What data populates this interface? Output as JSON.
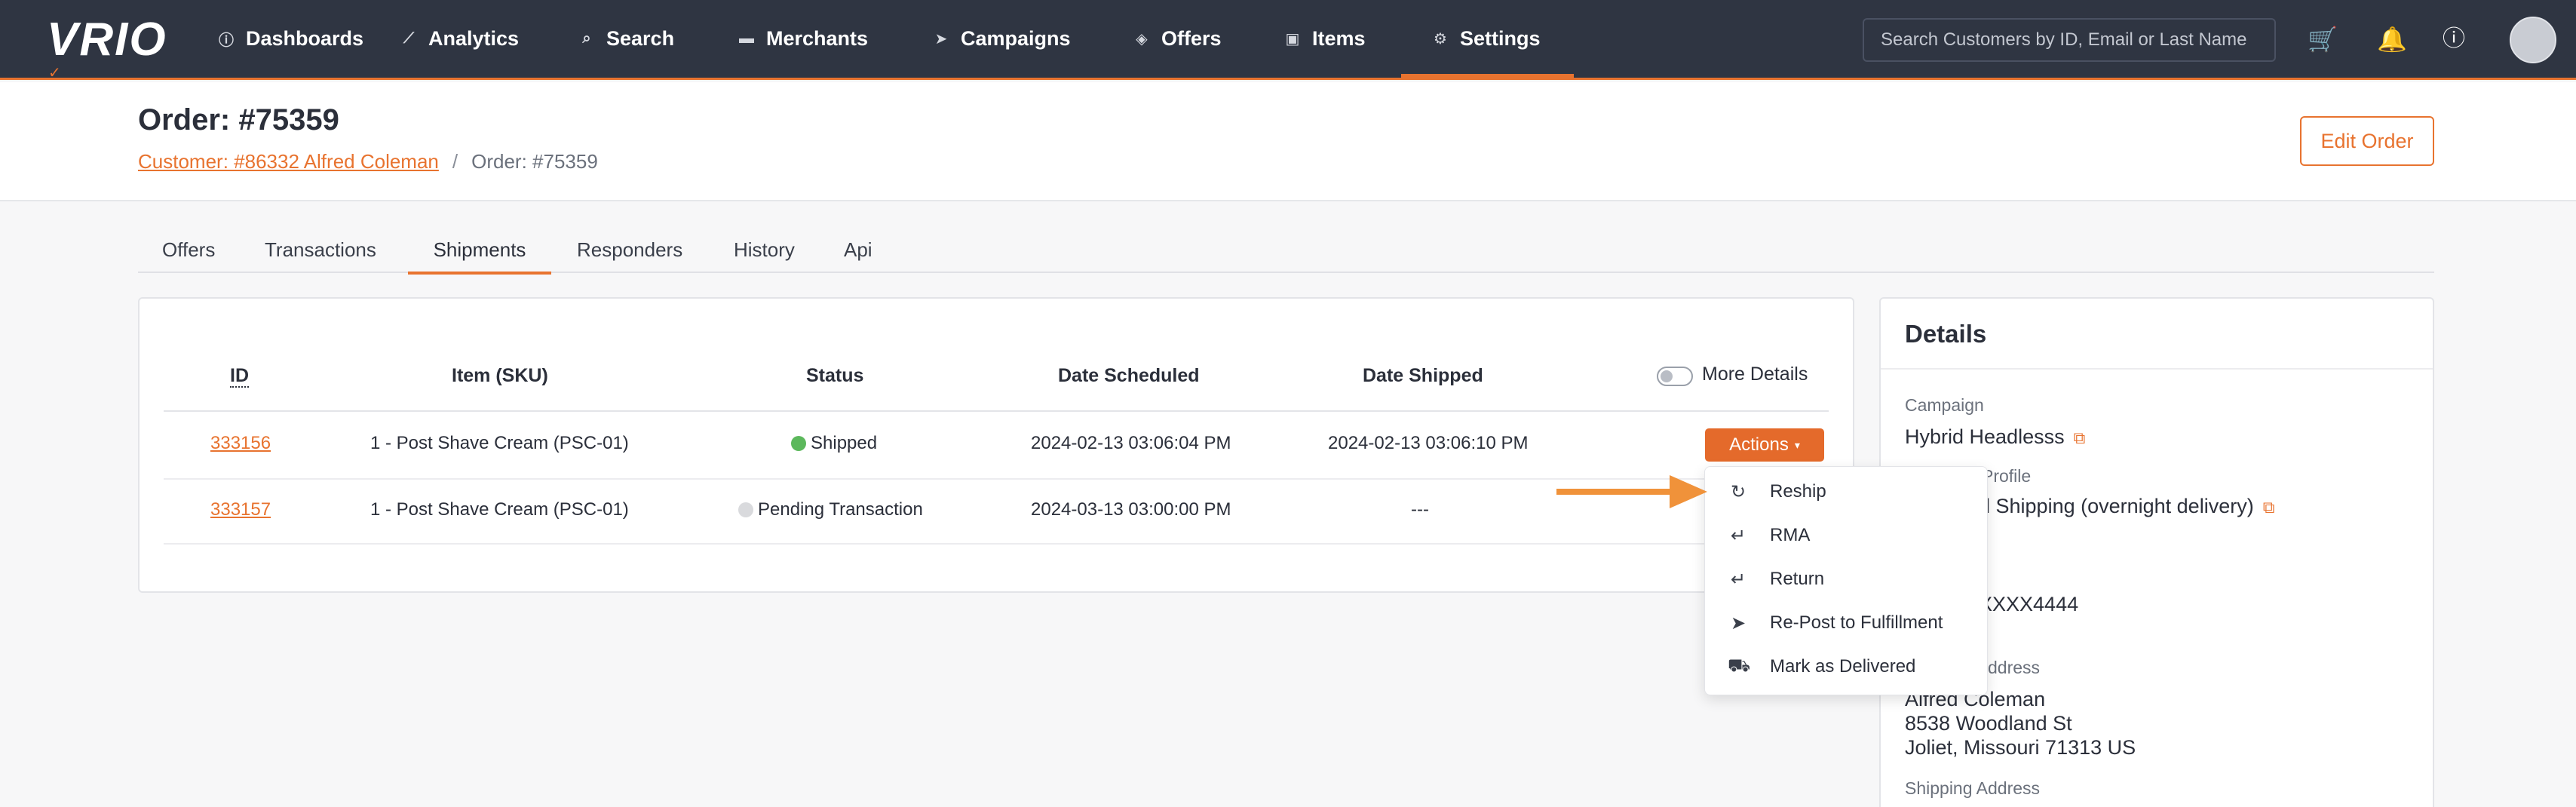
{
  "brand": {
    "logo": "VRIO"
  },
  "nav": {
    "items": [
      {
        "label": "Dashboards",
        "icon": "info-circle-icon"
      },
      {
        "label": "Analytics",
        "icon": "line-chart-icon"
      },
      {
        "label": "Search",
        "icon": "search-icon"
      },
      {
        "label": "Merchants",
        "icon": "card-icon"
      },
      {
        "label": "Campaigns",
        "icon": "paper-plane-icon"
      },
      {
        "label": "Offers",
        "icon": "layers-icon"
      },
      {
        "label": "Items",
        "icon": "box-icon"
      },
      {
        "label": "Settings",
        "icon": "gears-icon"
      }
    ],
    "active": "Settings",
    "search_placeholder": "Search Customers by ID, Email or Last Name"
  },
  "header": {
    "title": "Order: #75359",
    "breadcrumb": {
      "customer_link": "Customer: #86332 Alfred Coleman",
      "separator": "/",
      "current": "Order: #75359"
    },
    "edit_button": "Edit Order"
  },
  "tabs": [
    "Offers",
    "Transactions",
    "Shipments",
    "Responders",
    "History",
    "Api"
  ],
  "active_tab": "Shipments",
  "shipments": {
    "columns": [
      "ID",
      "Item (SKU)",
      "Status",
      "Date Scheduled",
      "Date Shipped"
    ],
    "more_details_label": "More Details",
    "rows": [
      {
        "id": "333156",
        "item": "1 - Post Shave Cream (PSC-01)",
        "status": "Shipped",
        "status_color": "#5cb85c",
        "date_scheduled": "2024-02-13 03:06:04 PM",
        "date_shipped": "2024-02-13 03:06:10 PM"
      },
      {
        "id": "333157",
        "item": "1 - Post Shave Cream (PSC-01)",
        "status": "Pending Transaction",
        "status_color": "#d9dadd",
        "date_scheduled": "2024-03-13 03:00:00 PM",
        "date_shipped": "---"
      }
    ],
    "actions_label": "Actions"
  },
  "actions_menu": [
    {
      "label": "Reship",
      "icon": "refresh-icon"
    },
    {
      "label": "RMA",
      "icon": "return-arrow-icon"
    },
    {
      "label": "Return",
      "icon": "return-arrow-icon"
    },
    {
      "label": "Re-Post to Fulfillment",
      "icon": "paper-plane-icon"
    },
    {
      "label": "Mark as Delivered",
      "icon": "truck-icon"
    }
  ],
  "details": {
    "title": "Details",
    "campaign_label": "Campaign",
    "campaign_value": "Hybrid Headlesss",
    "profile_label_fragment": "Profile",
    "profile_value_fragment": "d Shipping (overnight delivery)",
    "card_fragment": "XXXX4444",
    "billing_label_fragment": "ddress",
    "billing_name": "Alfred Coleman",
    "billing_street": "8538 Woodland St",
    "billing_city": "Joliet, Missouri 71313 US",
    "shipping_label": "Shipping Address"
  },
  "colors": {
    "accent": "#e8732f",
    "nav_bg": "#2f3542"
  }
}
